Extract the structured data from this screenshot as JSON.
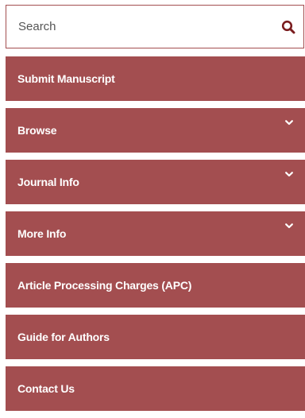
{
  "colors": {
    "accent": "#a34e50",
    "text_on_accent": "#ffffff",
    "search_border": "#a34e50",
    "search_icon": "#7a1c1e"
  },
  "search": {
    "placeholder": "Search",
    "value": "",
    "icon": "search-icon"
  },
  "menu": {
    "items": [
      {
        "label": "Submit Manuscript",
        "has_dropdown": false
      },
      {
        "label": "Browse",
        "has_dropdown": true,
        "icon": "chevron-down-icon"
      },
      {
        "label": "Journal Info",
        "has_dropdown": true,
        "icon": "chevron-down-icon"
      },
      {
        "label": "More Info",
        "has_dropdown": true,
        "icon": "chevron-down-icon"
      },
      {
        "label": "Article Processing Charges (APC)",
        "has_dropdown": false
      },
      {
        "label": "Guide for Authors",
        "has_dropdown": false
      },
      {
        "label": "Contact Us",
        "has_dropdown": false
      }
    ]
  }
}
